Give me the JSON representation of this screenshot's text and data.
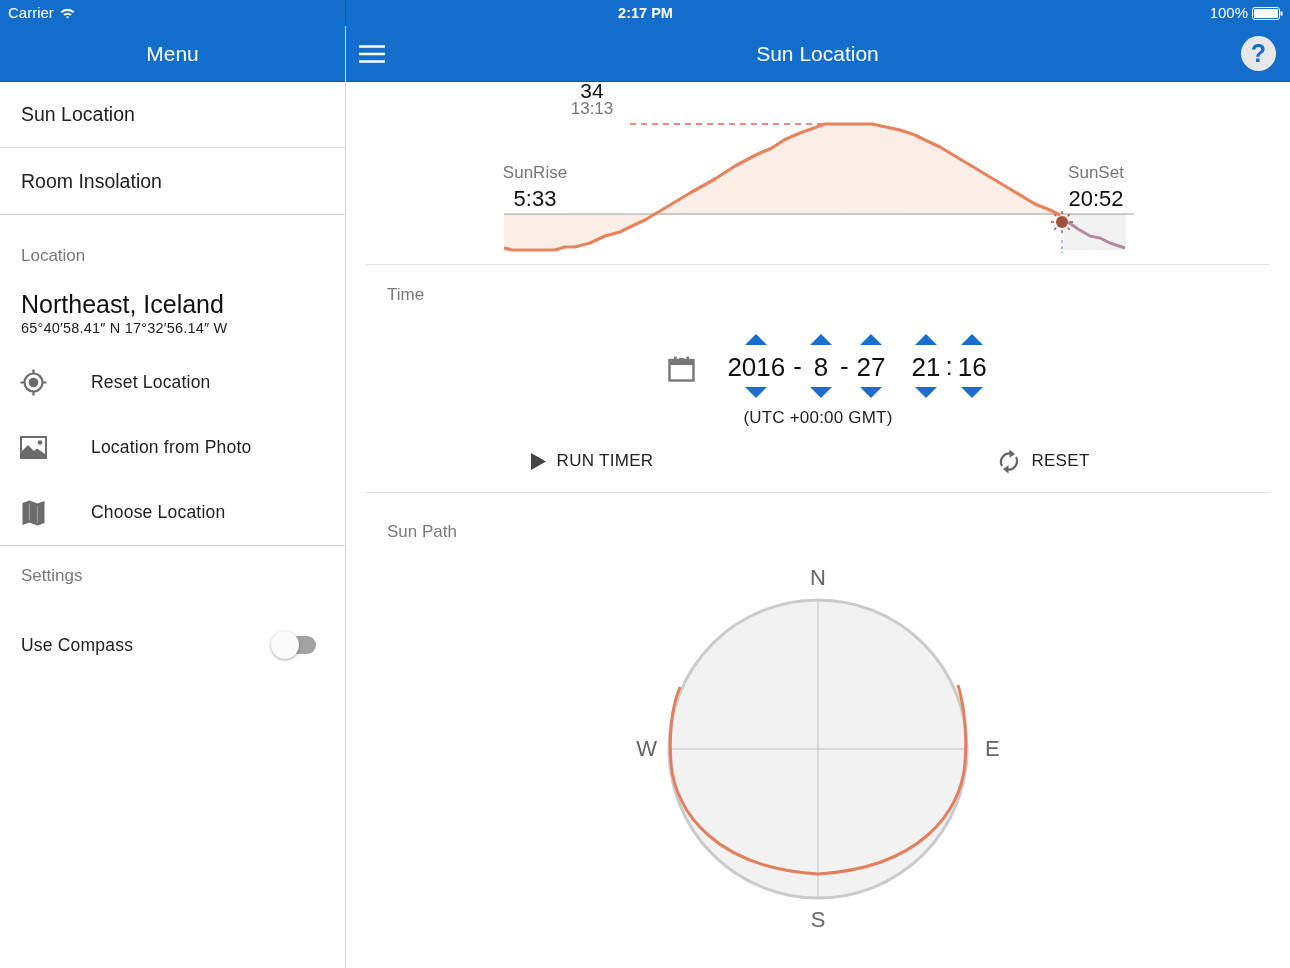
{
  "status_bar": {
    "carrier": "Carrier",
    "time": "2:17 PM",
    "battery": "100%"
  },
  "sidebar": {
    "title": "Menu",
    "nav_items": [
      "Sun Location",
      "Room Insolation"
    ],
    "location": {
      "heading": "Location",
      "place": "Northeast, Iceland",
      "coordinates": "65°40′58.41″ N 17°32′56.14″ W",
      "actions": [
        "Reset Location",
        "Location from Photo",
        "Choose Location"
      ]
    },
    "settings": {
      "heading": "Settings",
      "toggles": [
        {
          "label": "Use Compass",
          "on": false
        }
      ]
    }
  },
  "header": {
    "title": "Sun Location",
    "help_button": "?"
  },
  "elevation_graph": {
    "peak_value": "34",
    "peak_time": "13:13",
    "sunrise": {
      "label": "SunRise",
      "time": "5:33"
    },
    "sunset": {
      "label": "SunSet",
      "time": "20:52"
    }
  },
  "time": {
    "heading": "Time",
    "date_picker": [
      {
        "kind": "field",
        "value": "2016"
      },
      {
        "kind": "separator",
        "value": "-"
      },
      {
        "kind": "field",
        "value": "8"
      },
      {
        "kind": "separator",
        "value": "-"
      },
      {
        "kind": "field",
        "value": "27"
      }
    ],
    "time_picker": [
      {
        "kind": "field",
        "value": "21"
      },
      {
        "kind": "separator",
        "value": ":"
      },
      {
        "kind": "field",
        "value": "16"
      }
    ],
    "timezone": "(UTC +00:00 GMT)",
    "buttons": [
      "RUN TIMER",
      "RESET"
    ]
  },
  "sun_path": {
    "heading": "Sun Path",
    "directions": {
      "north": "N",
      "west": "W",
      "east": "E",
      "south": "S"
    }
  }
}
